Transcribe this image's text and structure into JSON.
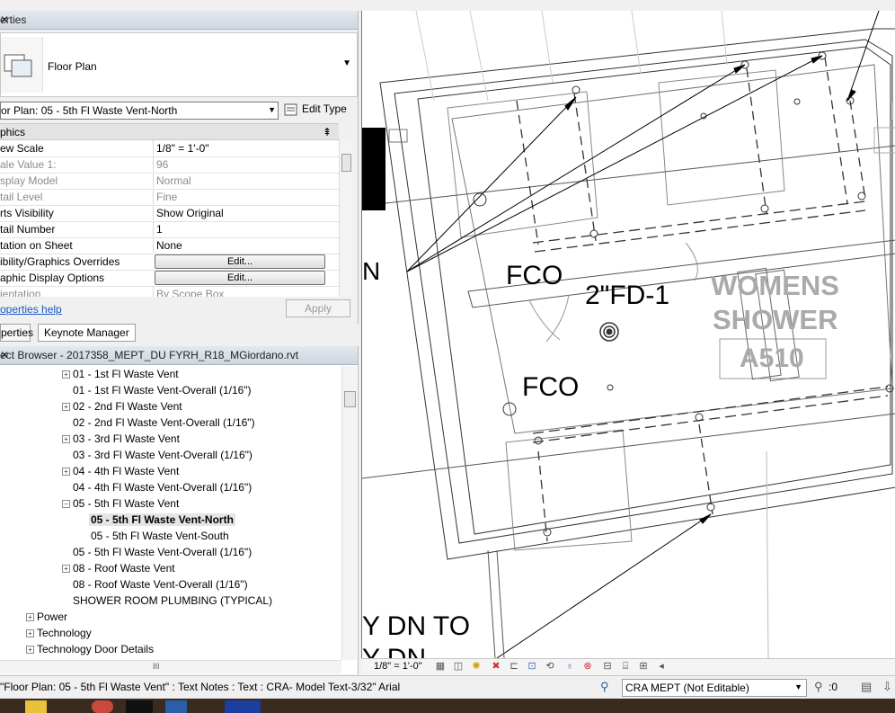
{
  "properties_panel": {
    "title": "erties",
    "type_selector": "Floor Plan",
    "instance_selector": "or Plan: 05 - 5th Fl Waste Vent-North",
    "edit_type_label": "Edit Type",
    "group_header": "phics",
    "rows": [
      {
        "name": "ew Scale",
        "value": "1/8\" = 1'-0\""
      },
      {
        "name": "ale Value   1:",
        "value": "96"
      },
      {
        "name": "splay Model",
        "value": "Normal"
      },
      {
        "name": "tail Level",
        "value": "Fine"
      },
      {
        "name": "rts Visibility",
        "value": "Show Original"
      },
      {
        "name": "tail Number",
        "value": "1"
      },
      {
        "name": "tation on Sheet",
        "value": "None"
      },
      {
        "name": "ibility/Graphics Overrides",
        "value": "Edit..."
      },
      {
        "name": "aphic Display Options",
        "value": "Edit..."
      },
      {
        "name": "ientation",
        "value": "By Scope Box"
      }
    ],
    "help_link": "operties help",
    "apply_label": "Apply"
  },
  "tabs": [
    "perties",
    "Keynote Manager"
  ],
  "project_browser": {
    "title": "ect Browser - 2017358_MEPT_DU FYRH_R18_MGiordano.rvt",
    "nodes": [
      {
        "label": "01 - 1st Fl Waste Vent",
        "expander": "+"
      },
      {
        "label": "01 - 1st Fl Waste Vent-Overall (1/16\")",
        "expander": ""
      },
      {
        "label": "02 - 2nd Fl Waste Vent",
        "expander": "+"
      },
      {
        "label": "02 - 2nd Fl Waste Vent-Overall (1/16\")",
        "expander": ""
      },
      {
        "label": "03 - 3rd Fl Waste Vent",
        "expander": "+"
      },
      {
        "label": "03 - 3rd Fl Waste Vent-Overall (1/16\")",
        "expander": ""
      },
      {
        "label": "04 - 4th Fl Waste Vent",
        "expander": "+"
      },
      {
        "label": "04 - 4th Fl Waste Vent-Overall (1/16\")",
        "expander": ""
      },
      {
        "label": "05 - 5th Fl Waste Vent",
        "expander": "−"
      },
      {
        "label": "05 - 5th Fl Waste Vent-North",
        "expander": ""
      },
      {
        "label": "05 - 5th Fl Waste Vent-South",
        "expander": ""
      },
      {
        "label": "05 - 5th Fl Waste Vent-Overall (1/16\")",
        "expander": ""
      },
      {
        "label": "08 - Roof Waste Vent",
        "expander": "+"
      },
      {
        "label": "08 - Roof Waste Vent-Overall (1/16\")",
        "expander": ""
      },
      {
        "label": "SHOWER ROOM PLUMBING (TYPICAL)",
        "expander": ""
      },
      {
        "label": "Power",
        "expander": "+"
      },
      {
        "label": "Technology",
        "expander": "+"
      },
      {
        "label": "Technology Door Details",
        "expander": "+"
      }
    ],
    "scroll_marker": "III"
  },
  "drawing": {
    "text_fco_1": "FCO",
    "text_fd": "2\"FD-1",
    "text_fco_2": "FCO",
    "text_room_1": "WOMENS",
    "text_room_2": "SHOWER",
    "text_room_tag": "A510",
    "text_n": "N",
    "text_dn_to": "Y DN TO",
    "text_dn": "Y DN",
    "text_edge_i": "I"
  },
  "view_control": {
    "scale": "1/8\" = 1'-0\""
  },
  "status_bar": {
    "message": "\"Floor Plan: 05 - 5th Fl Waste Vent\" : Text Notes : Text : CRA- Model Text-3/32\" Arial",
    "workset": "CRA MEPT (Not Editable)",
    "filter_count": ":0"
  }
}
